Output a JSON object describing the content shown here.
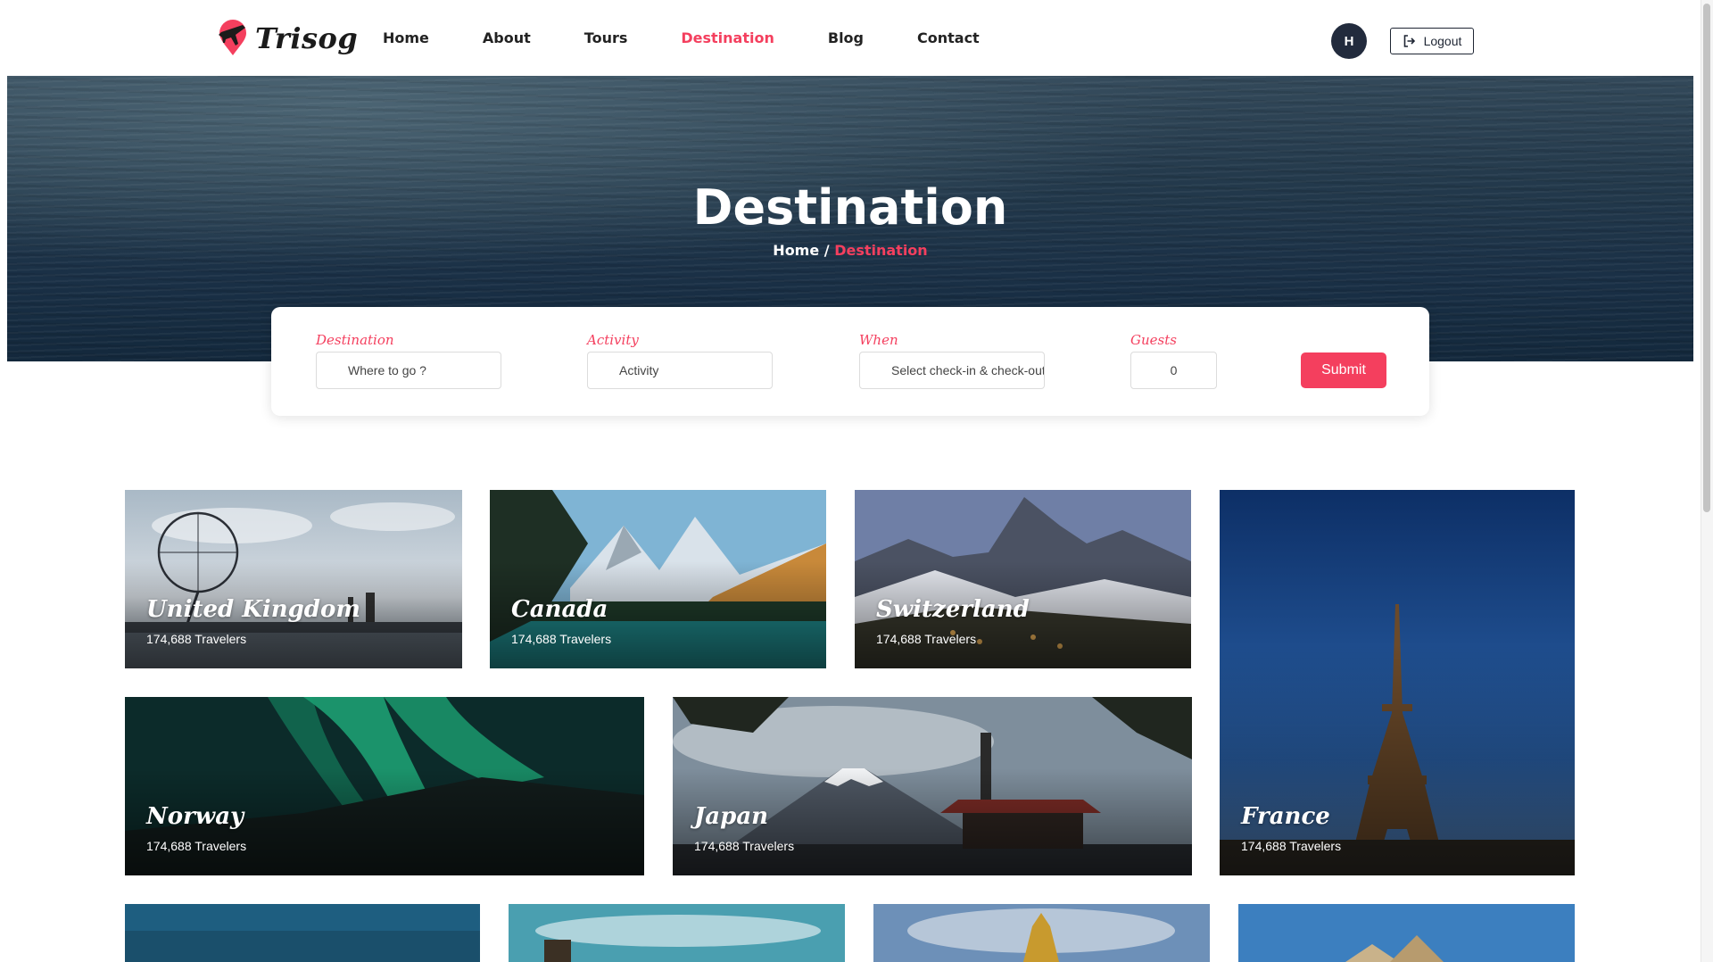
{
  "brand": {
    "name": "Trisog"
  },
  "nav": [
    {
      "label": "Home",
      "active": false
    },
    {
      "label": "About",
      "active": false
    },
    {
      "label": "Tours",
      "active": false
    },
    {
      "label": "Destination",
      "active": true
    },
    {
      "label": "Blog",
      "active": false
    },
    {
      "label": "Contact",
      "active": false
    }
  ],
  "user": {
    "initial": "H",
    "logout_label": "Logout"
  },
  "hero": {
    "title": "Destination",
    "breadcrumb_home": "Home",
    "breadcrumb_sep": " / ",
    "breadcrumb_current": "Destination"
  },
  "search": {
    "destination": {
      "label": "Destination",
      "placeholder": "Where to go ?"
    },
    "activity": {
      "label": "Activity",
      "placeholder": "Activity"
    },
    "when": {
      "label": "When",
      "placeholder": "Select check-in & check-out"
    },
    "guests": {
      "label": "Guests",
      "value": "0"
    },
    "submit_label": "Submit"
  },
  "destinations": [
    {
      "name": "United Kingdom",
      "travelers": "174,688 Travelers"
    },
    {
      "name": "Canada",
      "travelers": "174,688 Travelers"
    },
    {
      "name": "Switzerland",
      "travelers": "174,688 Travelers"
    },
    {
      "name": "France",
      "travelers": "174,688 Travelers"
    },
    {
      "name": "Norway",
      "travelers": "174,688 Travelers"
    },
    {
      "name": "Japan",
      "travelers": "174,688 Travelers"
    }
  ],
  "colors": {
    "accent": "#f43f5e",
    "dark": "#222b3d"
  }
}
